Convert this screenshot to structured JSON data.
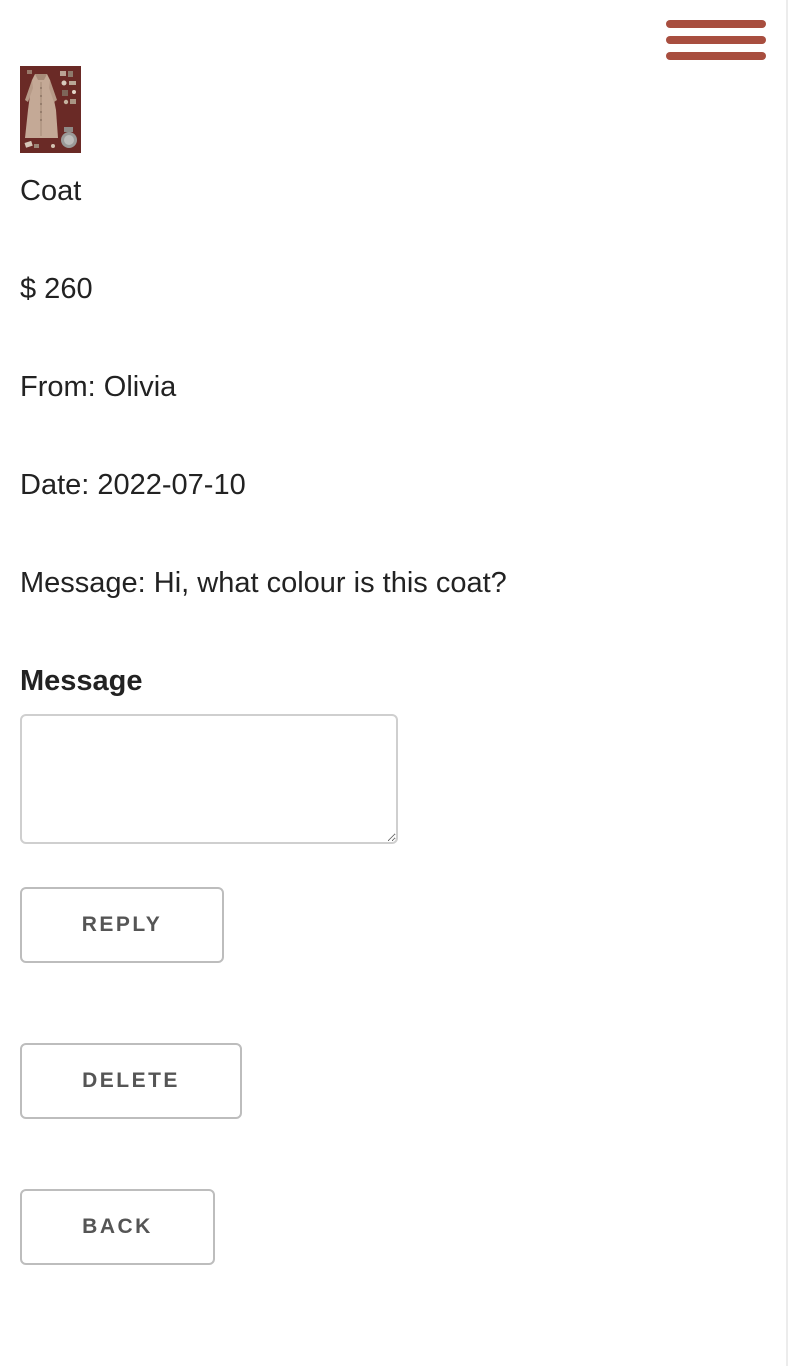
{
  "header": {
    "menu_icon": "hamburger-menu-icon",
    "accent_color": "#a84e3f"
  },
  "item": {
    "image_icon": "coat-product-image",
    "title": "Coat",
    "price": "$ 260",
    "from": "From: Olivia",
    "date": "Date: 2022-07-10",
    "message": "Message: Hi, what colour is this coat?"
  },
  "reply_form": {
    "label": "Message",
    "value": "",
    "placeholder": ""
  },
  "actions": {
    "reply_label": "REPLY",
    "delete_label": "DELETE",
    "back_label": "BACK"
  }
}
